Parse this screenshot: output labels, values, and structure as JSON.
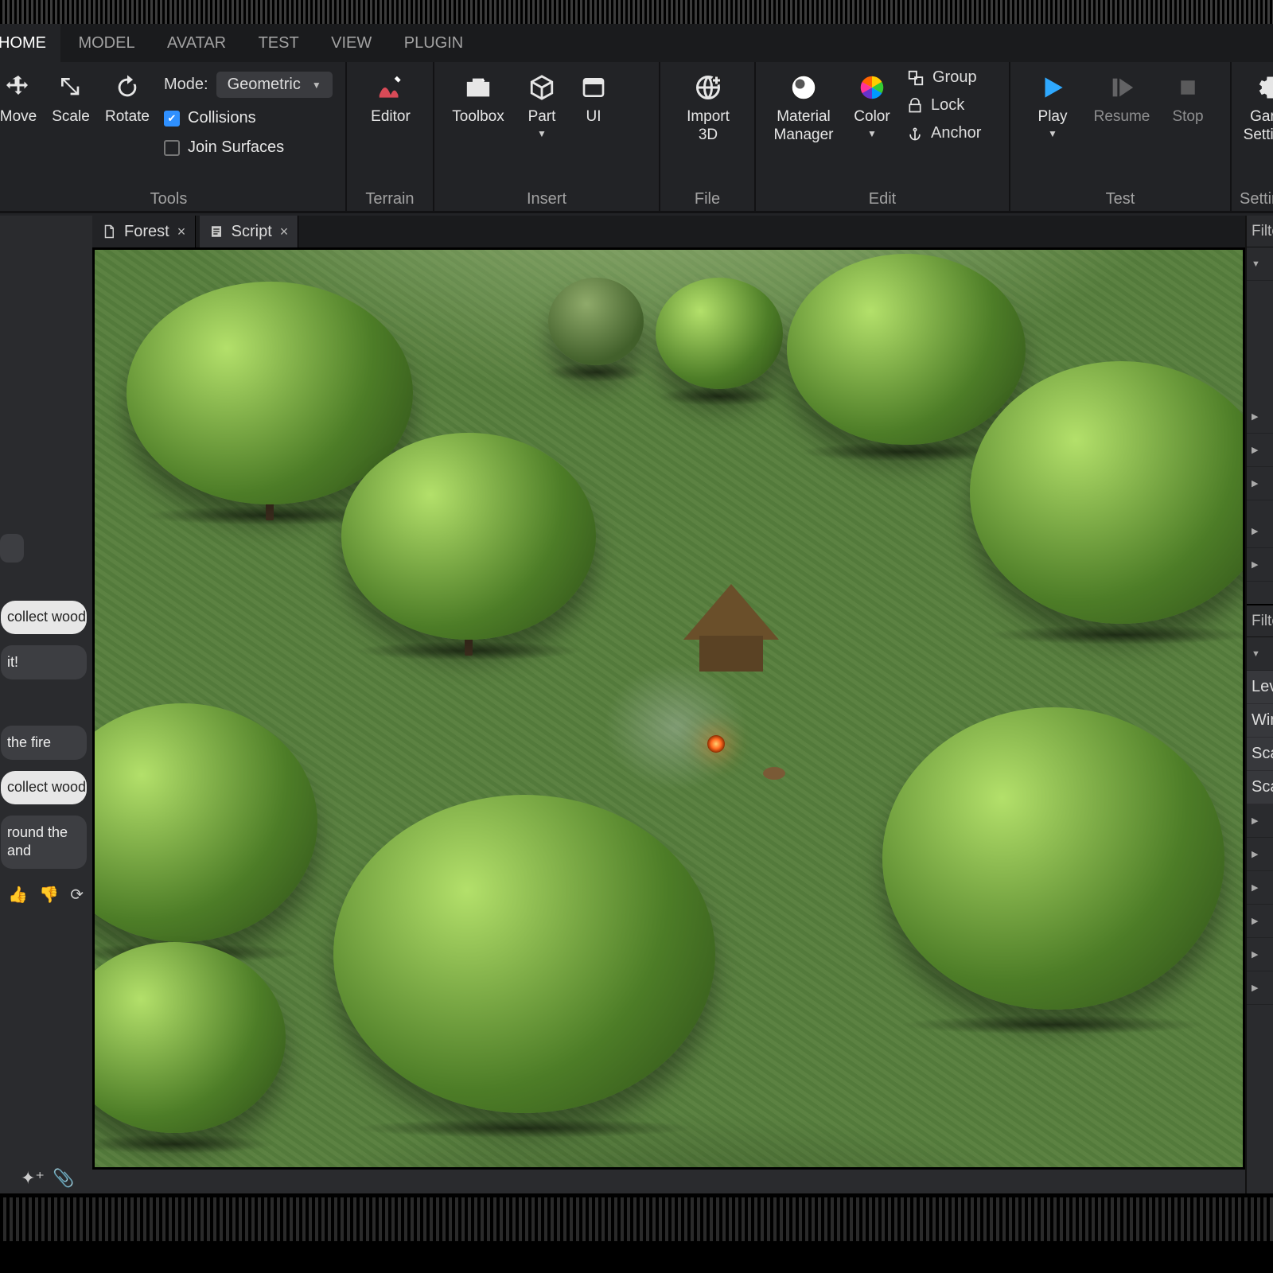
{
  "menu_tabs": {
    "home": "HOME",
    "model": "MODEL",
    "avatar": "AVATAR",
    "test": "TEST",
    "view": "VIEW",
    "plugin": "PLUGIN"
  },
  "ribbon": {
    "tools_group": "Tools",
    "terrain_group": "Terrain",
    "insert_group": "Insert",
    "file_group": "File",
    "edit_group": "Edit",
    "test_group": "Test",
    "settings_group": "Settings",
    "move": "Move",
    "scale": "Scale",
    "rotate": "Rotate",
    "mode_label": "Mode:",
    "mode_value": "Geometric",
    "collisions": "Collisions",
    "join": "Join Surfaces",
    "editor": "Editor",
    "toolbox": "Toolbox",
    "part": "Part",
    "ui": "UI",
    "import3d_l1": "Import",
    "import3d_l2": "3D",
    "material_l1": "Material",
    "material_l2": "Manager",
    "color": "Color",
    "group": "Group",
    "lock": "Lock",
    "anchor": "Anchor",
    "play": "Play",
    "resume": "Resume",
    "stop": "Stop",
    "game_l1": "Game",
    "game_l2": "Settings"
  },
  "doc_tabs": {
    "forest": "Forest",
    "script": "Script"
  },
  "right_panel": {
    "filter": "Filter",
    "filter2": "Filter",
    "prop1": "Level",
    "prop2": "Window",
    "prop3": "Scale",
    "prop4": "Scale"
  },
  "chat": {
    "m1": "collect wood",
    "m2": "it!",
    "m3": "the fire",
    "m4": "collect wood",
    "m5_l1": "round the",
    "m5_l2": "and"
  }
}
